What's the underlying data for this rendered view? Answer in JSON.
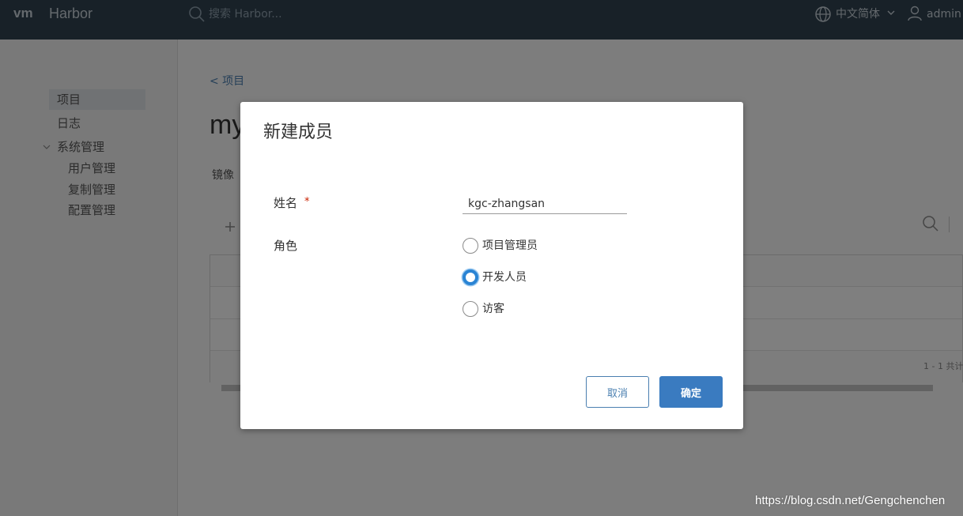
{
  "header": {
    "logo": "vm",
    "app_name": "Harbor",
    "search_placeholder": "搜索 Harbor...",
    "language": "中文简体",
    "user": "admin"
  },
  "sidebar": {
    "items": [
      {
        "label": "项目",
        "active": true
      },
      {
        "label": "日志"
      },
      {
        "label": "系统管理",
        "expanded": true
      },
      {
        "label": "用户管理"
      },
      {
        "label": "复制管理"
      },
      {
        "label": "配置管理"
      }
    ]
  },
  "page": {
    "breadcrumb": "< 项目",
    "title": "my",
    "tab": "镜像",
    "add": "+",
    "pagination": "1 - 1 共计"
  },
  "modal": {
    "title": "新建成员",
    "name_label": "姓名",
    "required_mark": "*",
    "name_value": "kgc-zhangsan",
    "role_label": "角色",
    "roles": [
      {
        "label": "项目管理员",
        "checked": false
      },
      {
        "label": "开发人员",
        "checked": true
      },
      {
        "label": "访客",
        "checked": false
      }
    ],
    "cancel": "取消",
    "ok": "确定"
  },
  "watermark": "https://blog.csdn.net/Gengchenchen",
  "colors": {
    "header_bg": "#314351",
    "primary": "#3a7bc0",
    "radio_checked": "#2a84d4",
    "required": "#c92100"
  }
}
